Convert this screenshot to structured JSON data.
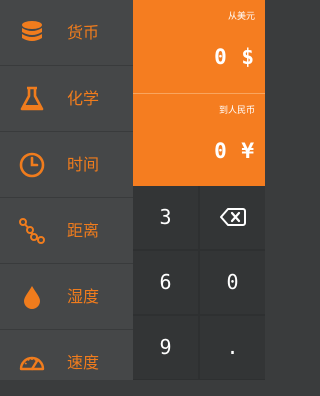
{
  "sidebar": {
    "items": [
      {
        "label": "货币",
        "icon": "coins-icon"
      },
      {
        "label": "化学",
        "icon": "flask-icon"
      },
      {
        "label": "时间",
        "icon": "clock-icon"
      },
      {
        "label": "距离",
        "icon": "route-icon"
      },
      {
        "label": "湿度",
        "icon": "drop-icon"
      },
      {
        "label": "速度",
        "icon": "speedometer-icon"
      }
    ]
  },
  "display": {
    "from": {
      "caption": "从美元",
      "value": "0 $"
    },
    "to": {
      "caption": "到人民币",
      "value": "0 ¥"
    }
  },
  "keypad": {
    "keys": [
      "3",
      "backspace",
      "6",
      "0",
      "9",
      "."
    ]
  },
  "colors": {
    "accent": "#f57d20",
    "sidebar_bg": "#454748",
    "keypad_bg": "#333536"
  }
}
